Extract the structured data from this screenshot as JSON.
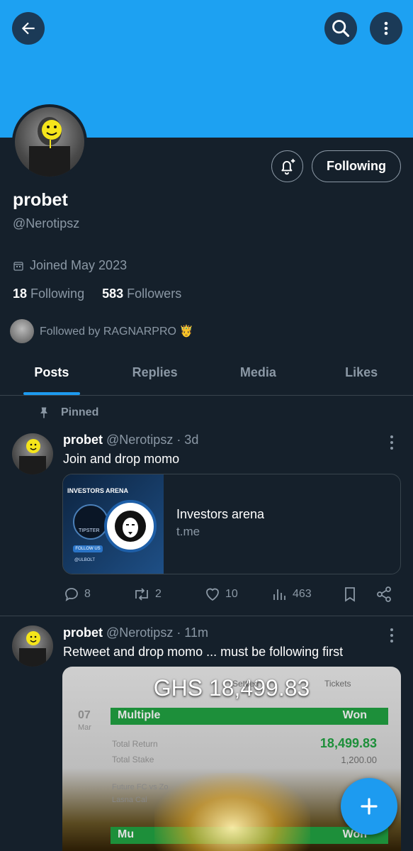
{
  "profile": {
    "name": "probet",
    "handle": "@Nerotipsz",
    "joined": "Joined May 2023",
    "following_count": "18",
    "following_label": "Following",
    "followers_count": "583",
    "followers_label": "Followers",
    "followed_by": "Followed by RAGNARPRO 🤴",
    "follow_button_label": "Following"
  },
  "tabs": [
    {
      "label": "Posts",
      "active": true
    },
    {
      "label": "Replies"
    },
    {
      "label": "Media"
    },
    {
      "label": "Likes"
    }
  ],
  "pinned_label": "Pinned",
  "tweets": [
    {
      "name": "probet",
      "meta": "@Nerotipsz · 3d",
      "text": "Join and drop momo",
      "card": {
        "title": "Investors arena",
        "domain": "t.me",
        "image_heading": "INVESTORS ARENA",
        "image_sub1": "TIPSTER",
        "image_sub2": "FOLLOW US",
        "image_sub3": "@ULBOLT"
      },
      "replies": "8",
      "retweets": "2",
      "likes": "10",
      "views": "463"
    },
    {
      "name": "probet",
      "meta": "@Nerotipsz · 11m",
      "text": "Retweet and drop momo ... must be following first",
      "media": {
        "headline": "GHS 18,499.83",
        "settled": "Settled",
        "tickets": "Tickets",
        "date_day": "07",
        "date_month": "Mar",
        "bet_type": "Multiple",
        "status": "Won",
        "total_return_label": "Total Return",
        "total_return": "18,499.83",
        "total_stake_label": "Total Stake",
        "total_stake": "1,200.00",
        "match1": "Future FC vs Zo",
        "match2": "Lasna Cal",
        "bet_type2": "Mu",
        "status2": "Won"
      }
    }
  ],
  "colors": {
    "banner": "#1da1f2",
    "background": "#15202b",
    "accent": "#1d9bf0",
    "muted": "#8b98a5"
  },
  "icons": [
    "back-arrow-icon",
    "search-icon",
    "more-vertical-icon",
    "bell-plus-icon",
    "calendar-icon",
    "pin-icon",
    "reply-icon",
    "retweet-icon",
    "heart-icon",
    "views-icon",
    "bookmark-icon",
    "share-icon",
    "plus-icon"
  ]
}
